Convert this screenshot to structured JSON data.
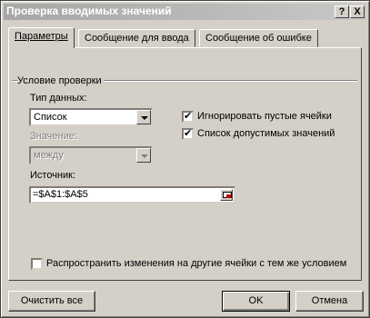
{
  "window": {
    "title": "Проверка вводимых значений"
  },
  "titlebar_buttons": {
    "help": "?",
    "close": "X"
  },
  "tabs": [
    {
      "label": "Параметры"
    },
    {
      "label": "Сообщение для ввода"
    },
    {
      "label": "Сообщение об ошибке"
    }
  ],
  "validation": {
    "group_label": "Условие проверки",
    "data_type_label": "Тип данных:",
    "data_type_value": "Список",
    "condition_label": "Значение:",
    "condition_value": "между",
    "ignore_blank_label": "Игнорировать пустые ячейки",
    "ignore_blank_checked": true,
    "in_cell_dropdown_label": "Список допустимых значений",
    "in_cell_dropdown_checked": true,
    "source_label": "Источник:",
    "source_value": "=$A$1:$A$5",
    "apply_all_label": "Распространить изменения на другие ячейки с тем же условием",
    "apply_all_checked": false
  },
  "buttons": {
    "clear_all": "Очистить все",
    "ok": "OK",
    "cancel": "Отмена"
  },
  "icons": {
    "checkmark": "✔",
    "reference": "range-select-icon"
  }
}
